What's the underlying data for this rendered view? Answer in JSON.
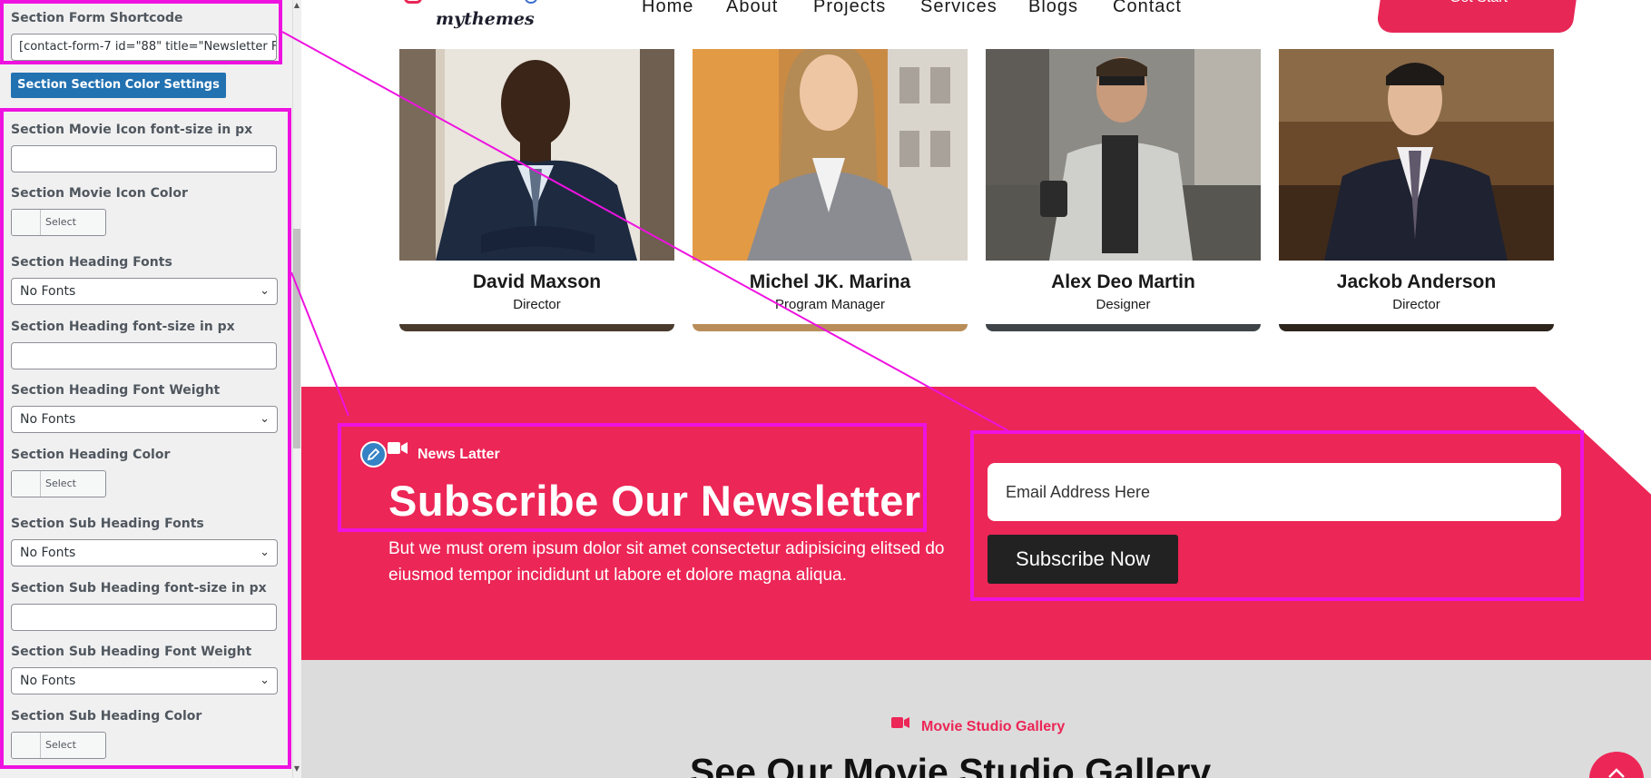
{
  "sidebar": {
    "form_shortcode": {
      "label": "Section Form Shortcode",
      "value": "[contact-form-7 id=\"88\" title=\"Newsletter F"
    },
    "color_settings_button": "Section Section Color Settings",
    "movie_icon_size": {
      "label": "Section Movie Icon font-size in px",
      "value": ""
    },
    "movie_icon_color": {
      "label": "Section Movie Icon Color",
      "button": "Select Color"
    },
    "heading_fonts": {
      "label": "Section Heading Fonts",
      "value": "No Fonts"
    },
    "heading_size": {
      "label": "Section Heading font-size in px",
      "value": ""
    },
    "heading_weight": {
      "label": "Section Heading Font Weight",
      "value": "No Fonts"
    },
    "heading_color": {
      "label": "Section Heading Color",
      "button": "Select Color"
    },
    "sub_heading_fonts": {
      "label": "Section Sub Heading Fonts",
      "value": "No Fonts"
    },
    "sub_heading_size": {
      "label": "Section Sub Heading font-size in px",
      "value": ""
    },
    "sub_heading_weight": {
      "label": "Section Sub Heading Font Weight",
      "value": "No Fonts"
    },
    "sub_heading_color": {
      "label": "Section Sub Heading Color",
      "button": "Select Color"
    }
  },
  "header": {
    "logo_text": "mythemes",
    "nav": [
      "Home",
      "About",
      "Projects",
      "Services",
      "Blogs",
      "Contact"
    ],
    "cta": "Get Start"
  },
  "team": [
    {
      "name": "David Maxson",
      "role": "Director"
    },
    {
      "name": "Michel JK. Marina",
      "role": "Program Manager"
    },
    {
      "name": "Alex Deo Martin",
      "role": "Designer"
    },
    {
      "name": "Jackob Anderson",
      "role": "Director"
    }
  ],
  "newsletter": {
    "tag": "News Latter",
    "title": "Subscribe Our Newsletter",
    "description": "But we must orem ipsum dolor sit amet consectetur adipisicing elitsed do eiusmod tempor incididunt ut labore et dolore magna aliqua.",
    "email_placeholder": "Email Address Here",
    "submit": "Subscribe Now"
  },
  "gallery": {
    "tag": "Movie Studio Gallery",
    "title": "See Our Movie Studio Gallery"
  },
  "colors": {
    "brand_pink": "#ec2656",
    "highlight_magenta": "#ee12e0",
    "wp_blue": "#2271b1",
    "dark_button": "#222222"
  },
  "icons": [
    "movie-camera-icon",
    "pencil-icon",
    "chevron-down-icon",
    "arrow-up-icon"
  ]
}
